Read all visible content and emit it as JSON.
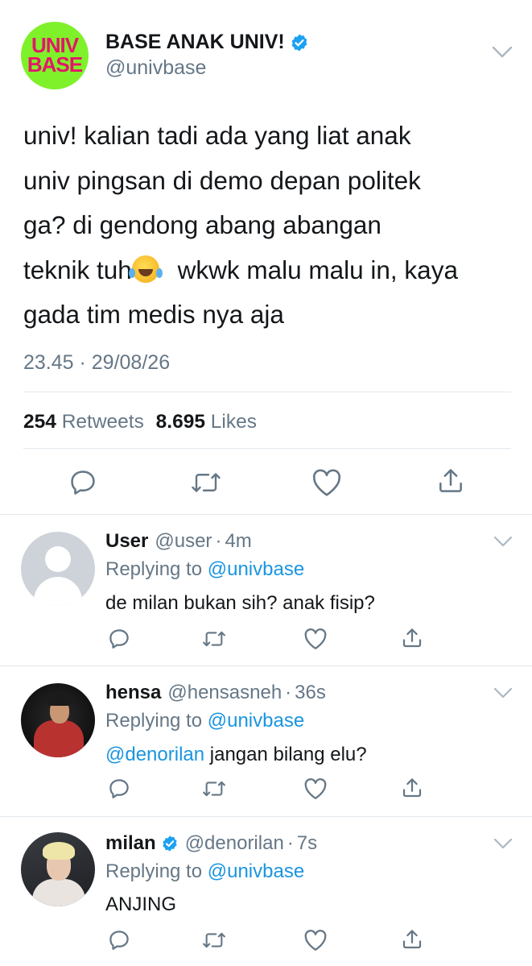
{
  "main_tweet": {
    "avatar_text": [
      "UNIV",
      "BASE"
    ],
    "display_name": "BASE ANAK UNIV!",
    "verified": true,
    "handle": "@univbase",
    "text_parts": {
      "line1": "univ! kalian tadi ada yang liat anak",
      "line2": "univ pingsan di demo depan politek",
      "line3": "ga? di gendong abang abangan",
      "line4a": "teknik tuh",
      "emoji": "face-with-tears-of-joy",
      "line4b": " wkwk malu malu in, kaya",
      "line5": "gada tim medis nya aja"
    },
    "timestamp": "23.45 · 29/08/26",
    "retweets_count": "254",
    "retweets_label": "Retweets",
    "likes_count": "8.695",
    "likes_label": "Likes"
  },
  "action_icons": [
    "reply-icon",
    "retweet-icon",
    "like-icon",
    "share-icon"
  ],
  "replies": [
    {
      "name": "User",
      "handle": "@user",
      "time": "4m",
      "verified": false,
      "replying_label": "Replying to",
      "replying_to": "@univbase",
      "mention": "",
      "text": "de milan bukan sih? anak fisip?"
    },
    {
      "name": "hensa",
      "handle": "@hensasneh",
      "time": "36s",
      "verified": false,
      "replying_label": "Replying to",
      "replying_to": "@univbase",
      "mention": "@denorilan",
      "text": " jangan bilang elu?"
    },
    {
      "name": "milan",
      "handle": "@denorilan",
      "time": "7s",
      "verified": true,
      "replying_label": "Replying to",
      "replying_to": "@univbase",
      "mention": "",
      "text": "ANJING"
    }
  ],
  "colors": {
    "text": "#14171a",
    "secondary": "#657786",
    "link": "#1b95e0",
    "verified": "#1da1f2",
    "divider": "#e1e8ed",
    "logo_bg": "#7ff12a",
    "logo_text": "#e5156a"
  }
}
